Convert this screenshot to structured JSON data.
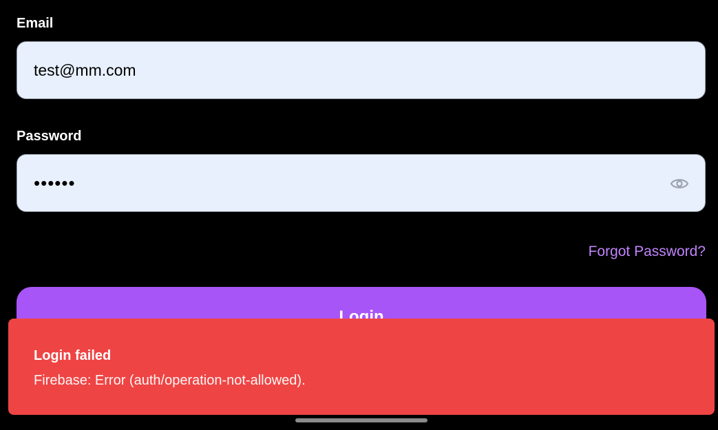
{
  "form": {
    "email_label": "Email",
    "email_value": "test@mm.com",
    "password_label": "Password",
    "password_value": "••••••",
    "password_toggle_icon": "eye-icon",
    "forgot_password_label": "Forgot Password?",
    "login_label": "Login"
  },
  "toast": {
    "title": "Login failed",
    "message": "Firebase: Error (auth/operation-not-allowed)."
  },
  "colors": {
    "background": "#000000",
    "input_background": "#e8f0fe",
    "accent": "#a855f7",
    "link": "#c084fc",
    "error": "#ef4444"
  }
}
